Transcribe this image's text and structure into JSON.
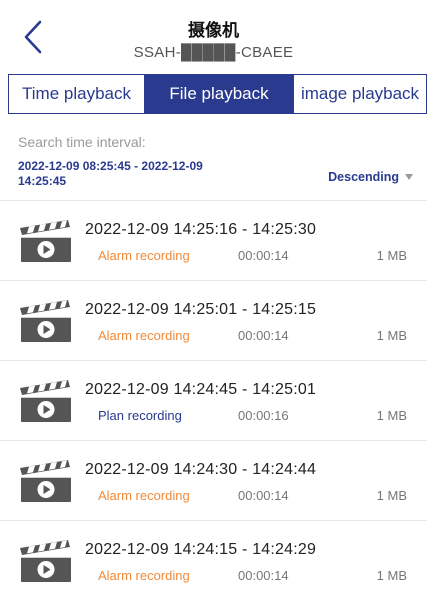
{
  "header": {
    "title": "摄像机",
    "subtitle": "SSAH-█████-CBAEE"
  },
  "tabs": [
    {
      "label": "Time playback",
      "active": false
    },
    {
      "label": "File playback",
      "active": true
    },
    {
      "label": "image playback",
      "active": false
    }
  ],
  "search": {
    "label": "Search time interval:",
    "range_line1": "2022-12-09 08:25:45 - 2022-12-09",
    "range_line2": "14:25:45",
    "sort_label": "Descending"
  },
  "colors": {
    "accent": "#2a3a8e",
    "alarm": "#f08a3a",
    "plan": "#2a3a8e",
    "icon": "#555555"
  },
  "recordings": [
    {
      "time": "2022-12-09  14:25:16 - 14:25:30",
      "type": "Alarm recording",
      "kind": "alarm",
      "duration": "00:00:14",
      "size": "1 MB"
    },
    {
      "time": "2022-12-09  14:25:01 - 14:25:15",
      "type": "Alarm recording",
      "kind": "alarm",
      "duration": "00:00:14",
      "size": "1 MB"
    },
    {
      "time": "2022-12-09  14:24:45 - 14:25:01",
      "type": "Plan recording",
      "kind": "plan",
      "duration": "00:00:16",
      "size": "1 MB"
    },
    {
      "time": "2022-12-09  14:24:30 - 14:24:44",
      "type": "Alarm recording",
      "kind": "alarm",
      "duration": "00:00:14",
      "size": "1 MB"
    },
    {
      "time": "2022-12-09  14:24:15 - 14:24:29",
      "type": "Alarm recording",
      "kind": "alarm",
      "duration": "00:00:14",
      "size": "1 MB"
    }
  ]
}
